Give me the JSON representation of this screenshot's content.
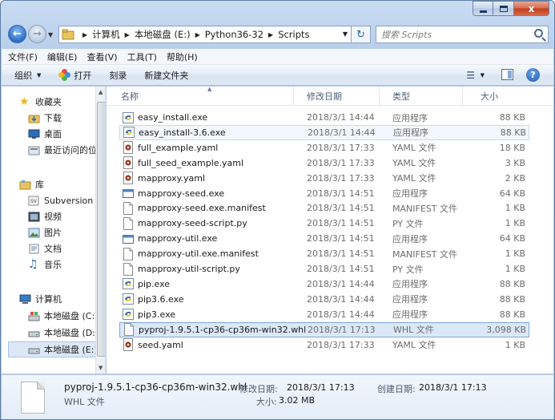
{
  "window": {
    "controls": {
      "close": "x"
    }
  },
  "address": {
    "crumbs": [
      "计算机",
      "本地磁盘 (E:)",
      "Python36-32",
      "Scripts"
    ]
  },
  "search": {
    "placeholder": "搜索 Scripts"
  },
  "menu": [
    "文件(F)",
    "编辑(E)",
    "查看(V)",
    "工具(T)",
    "帮助(H)"
  ],
  "toolbar": {
    "organize": "组织",
    "open": "打开",
    "burn": "刻录",
    "new_folder": "新建文件夹"
  },
  "nav": {
    "favorites": "收藏夹",
    "downloads": "下载",
    "desktop": "桌面",
    "recent": "最近访问的位置",
    "libraries": "库",
    "subversion": "Subversion",
    "videos": "视频",
    "pictures": "图片",
    "documents": "文档",
    "music": "音乐",
    "computer": "计算机",
    "drive_c": "本地磁盘 (C:)",
    "drive_d": "本地磁盘 (D:)",
    "drive_e": "本地磁盘 (E:)"
  },
  "columns": {
    "name": "名称",
    "date": "修改日期",
    "type": "类型",
    "size": "大小"
  },
  "files": [
    {
      "name": "easy_install.exe",
      "date": "2018/3/1 14:44",
      "type": "应用程序",
      "size": "88 KB",
      "icon": "python-exe-icon"
    },
    {
      "name": "easy_install-3.6.exe",
      "date": "2018/3/1 14:44",
      "type": "应用程序",
      "size": "88 KB",
      "icon": "python-exe-icon"
    },
    {
      "name": "full_example.yaml",
      "date": "2018/3/1 17:33",
      "type": "YAML 文件",
      "size": "18 KB",
      "icon": "yaml-file-icon"
    },
    {
      "name": "full_seed_example.yaml",
      "date": "2018/3/1 17:33",
      "type": "YAML 文件",
      "size": "3 KB",
      "icon": "yaml-file-icon"
    },
    {
      "name": "mapproxy.yaml",
      "date": "2018/3/1 17:33",
      "type": "YAML 文件",
      "size": "2 KB",
      "icon": "yaml-file-icon"
    },
    {
      "name": "mapproxy-seed.exe",
      "date": "2018/3/1 14:51",
      "type": "应用程序",
      "size": "64 KB",
      "icon": "exe-window-icon"
    },
    {
      "name": "mapproxy-seed.exe.manifest",
      "date": "2018/3/1 14:51",
      "type": "MANIFEST 文件",
      "size": "1 KB",
      "icon": "blank-file-icon"
    },
    {
      "name": "mapproxy-seed-script.py",
      "date": "2018/3/1 14:51",
      "type": "PY 文件",
      "size": "1 KB",
      "icon": "blank-file-icon"
    },
    {
      "name": "mapproxy-util.exe",
      "date": "2018/3/1 14:51",
      "type": "应用程序",
      "size": "64 KB",
      "icon": "exe-window-icon"
    },
    {
      "name": "mapproxy-util.exe.manifest",
      "date": "2018/3/1 14:51",
      "type": "MANIFEST 文件",
      "size": "1 KB",
      "icon": "blank-file-icon"
    },
    {
      "name": "mapproxy-util-script.py",
      "date": "2018/3/1 14:51",
      "type": "PY 文件",
      "size": "1 KB",
      "icon": "blank-file-icon"
    },
    {
      "name": "pip.exe",
      "date": "2018/3/1 14:44",
      "type": "应用程序",
      "size": "88 KB",
      "icon": "python-exe-icon"
    },
    {
      "name": "pip3.6.exe",
      "date": "2018/3/1 14:44",
      "type": "应用程序",
      "size": "88 KB",
      "icon": "python-exe-icon"
    },
    {
      "name": "pip3.exe",
      "date": "2018/3/1 14:44",
      "type": "应用程序",
      "size": "88 KB",
      "icon": "python-exe-icon"
    },
    {
      "name": "pyproj-1.9.5.1-cp36-cp36m-win32.whl",
      "date": "2018/3/1 17:13",
      "type": "WHL 文件",
      "size": "3,098 KB",
      "icon": "blank-file-icon"
    },
    {
      "name": "seed.yaml",
      "date": "2018/3/1 17:33",
      "type": "YAML 文件",
      "size": "1 KB",
      "icon": "yaml-file-icon"
    }
  ],
  "details": {
    "name": "pyproj-1.9.5.1-cp36-cp36m-win32.whl",
    "type": "WHL 文件",
    "modified_label": "修改日期:",
    "modified_value": "2018/3/1 17:13",
    "created_label": "创建日期:",
    "created_value": "2018/3/1 17:13",
    "size_label": "大小:",
    "size_value": "3.02 MB"
  }
}
